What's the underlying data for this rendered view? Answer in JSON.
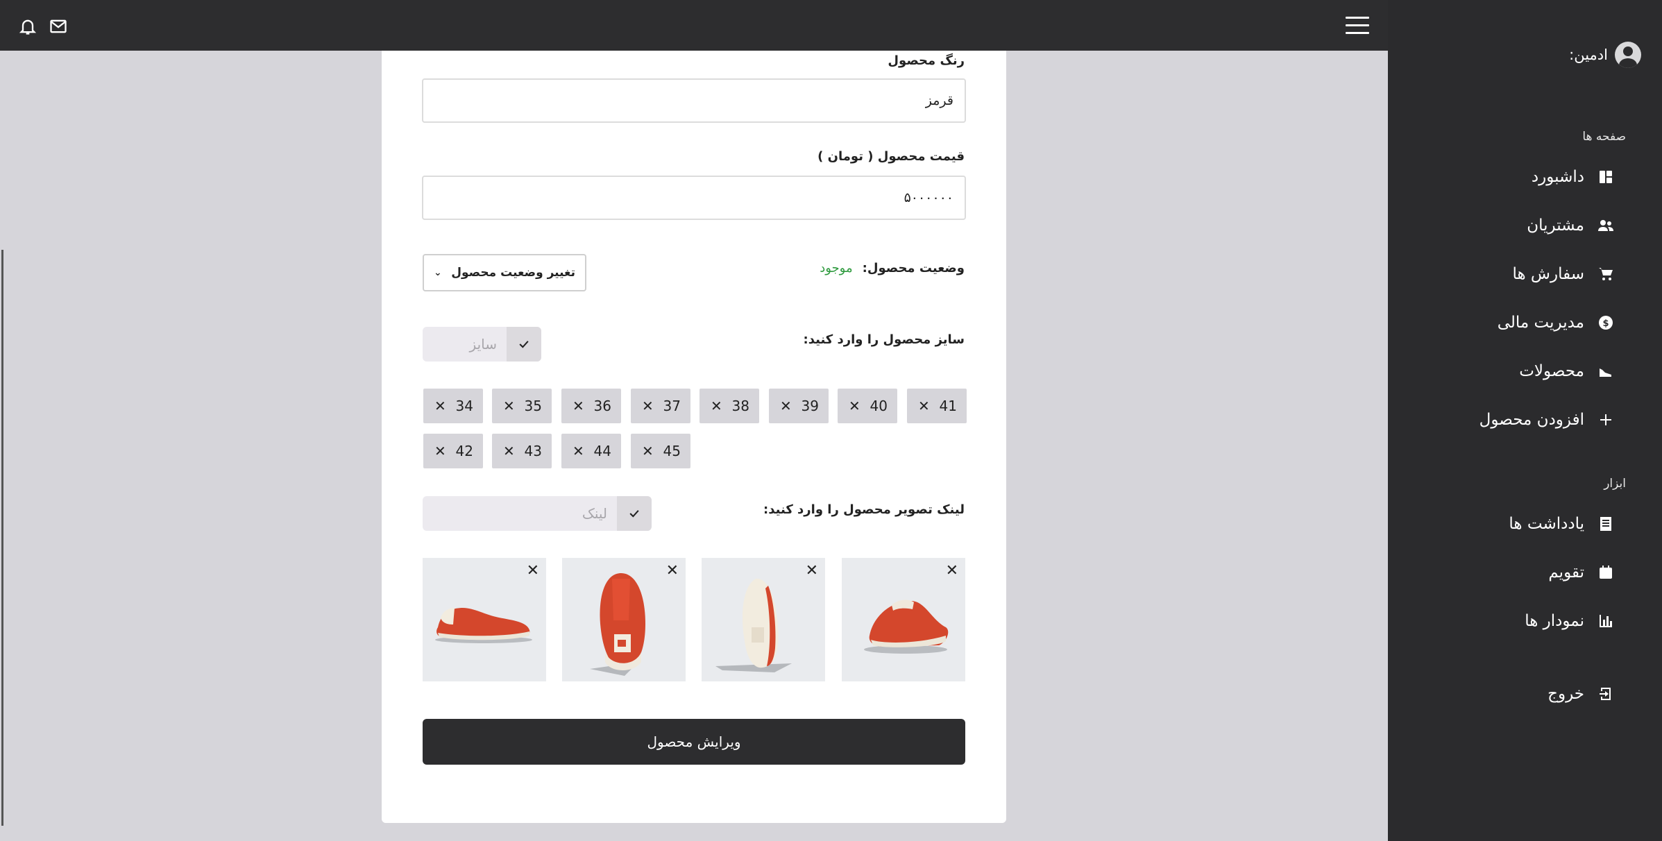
{
  "sidebar": {
    "admin_label": "ادمین:",
    "pages_section": "صفحه ها",
    "tools_section": "ابزار",
    "items": [
      {
        "label": "داشبورد",
        "icon": "dashboard-icon"
      },
      {
        "label": "مشتریان",
        "icon": "users-icon"
      },
      {
        "label": "سفارش ها",
        "icon": "cart-icon"
      },
      {
        "label": "مدیریت مالی",
        "icon": "dollar-icon"
      },
      {
        "label": "محصولات",
        "icon": "shoe-icon"
      },
      {
        "label": "افزودن محصول",
        "icon": "plus-icon"
      }
    ],
    "tools": [
      {
        "label": "یادداشت ها",
        "icon": "notes-icon"
      },
      {
        "label": "تقویم",
        "icon": "calendar-icon"
      },
      {
        "label": "نمودار ها",
        "icon": "chart-icon"
      }
    ],
    "logout": "خروج"
  },
  "form": {
    "color_label": "رنگ محصول",
    "color_value": "قرمز",
    "price_label": "قیمت محصول ( تومان )",
    "price_value": "۵۰۰۰۰۰۰",
    "status_label": "وضعیت محصول:",
    "status_value": "موجود",
    "status_color": "#2e9a3e",
    "status_select": "تغییر وضعیت محصول",
    "size_label": "سایز محصول را وارد کنید:",
    "size_placeholder": "سایز",
    "sizes": [
      "41",
      "40",
      "39",
      "38",
      "37",
      "36",
      "35",
      "34",
      "45",
      "44",
      "43",
      "42"
    ],
    "image_label": "لینک تصویر محصول را وارد کنید:",
    "image_placeholder": "لینک",
    "submit": "ویرایش محصول"
  }
}
